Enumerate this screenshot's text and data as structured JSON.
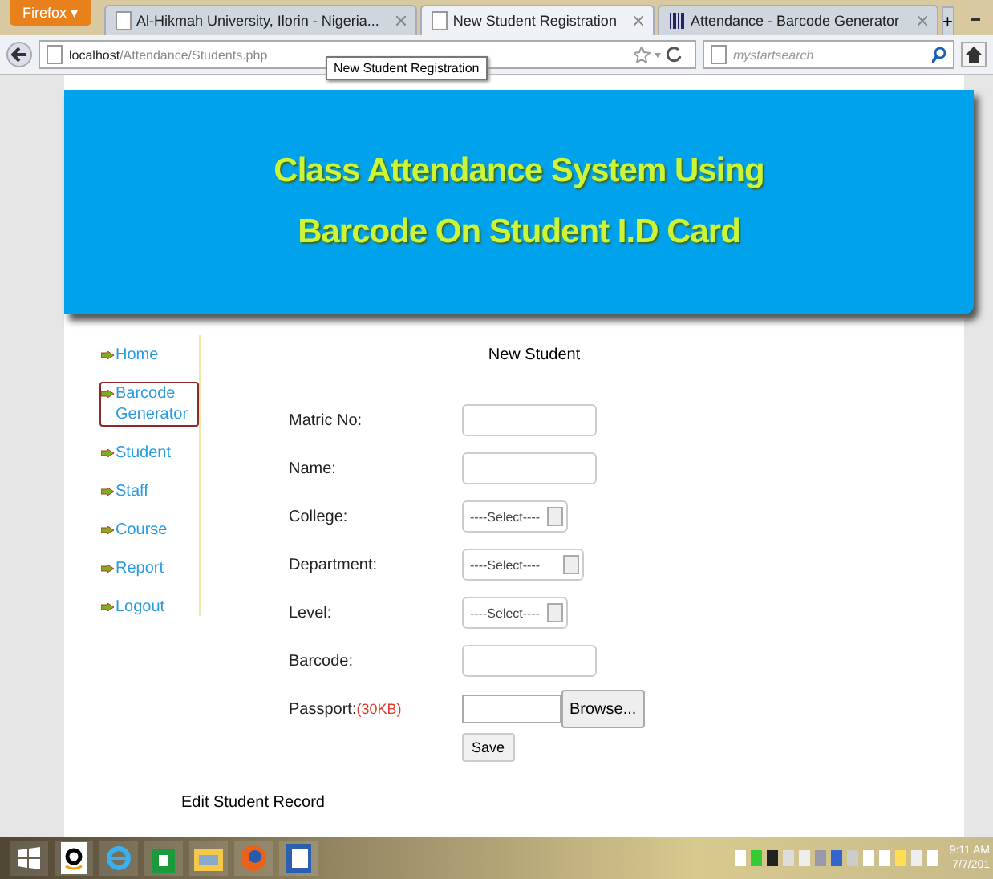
{
  "browser": {
    "menu_button": "Firefox ▾",
    "tabs": [
      {
        "title": "Al-Hikmah University, Ilorin - Nigeria...",
        "selected": false
      },
      {
        "title": "New Student Registration",
        "selected": true
      },
      {
        "title": "Attendance - Barcode Generator",
        "selected": false
      }
    ],
    "new_tab": "+",
    "address_host": "localhost",
    "address_path": "/Attendance/Students.php",
    "tooltip": "New Student Registration",
    "search_placeholder": "mystartsearch"
  },
  "header": {
    "title_lines": [
      "Class Attendance System Using",
      "Barcode On Student I.D Card"
    ]
  },
  "sidebar": {
    "items": [
      {
        "label": "Home",
        "selected": false
      },
      {
        "label": "Barcode Generator",
        "selected": true
      },
      {
        "label": "Student",
        "selected": false
      },
      {
        "label": "Staff",
        "selected": false
      },
      {
        "label": "Course",
        "selected": false
      },
      {
        "label": "Report",
        "selected": false
      },
      {
        "label": "Logout",
        "selected": false
      }
    ]
  },
  "form": {
    "title": "New Student",
    "fields": [
      {
        "kind": "text",
        "label": "Matric No:"
      },
      {
        "kind": "text",
        "label": "Name:"
      },
      {
        "kind": "select",
        "label": "College:",
        "value": "----Select----"
      },
      {
        "kind": "select",
        "label": "Department:",
        "value": "----Select----",
        "wide": true
      },
      {
        "kind": "select",
        "label": "Level:",
        "value": "----Select----"
      },
      {
        "kind": "text",
        "label": "Barcode:"
      },
      {
        "kind": "file",
        "label": "Passport:",
        "note": "(30KB)",
        "button": "Browse..."
      }
    ],
    "save_button": "Save"
  },
  "edit_heading": "Edit Student Record",
  "taskbar": {
    "time": "9:11 AM",
    "date": "7/7/201"
  }
}
